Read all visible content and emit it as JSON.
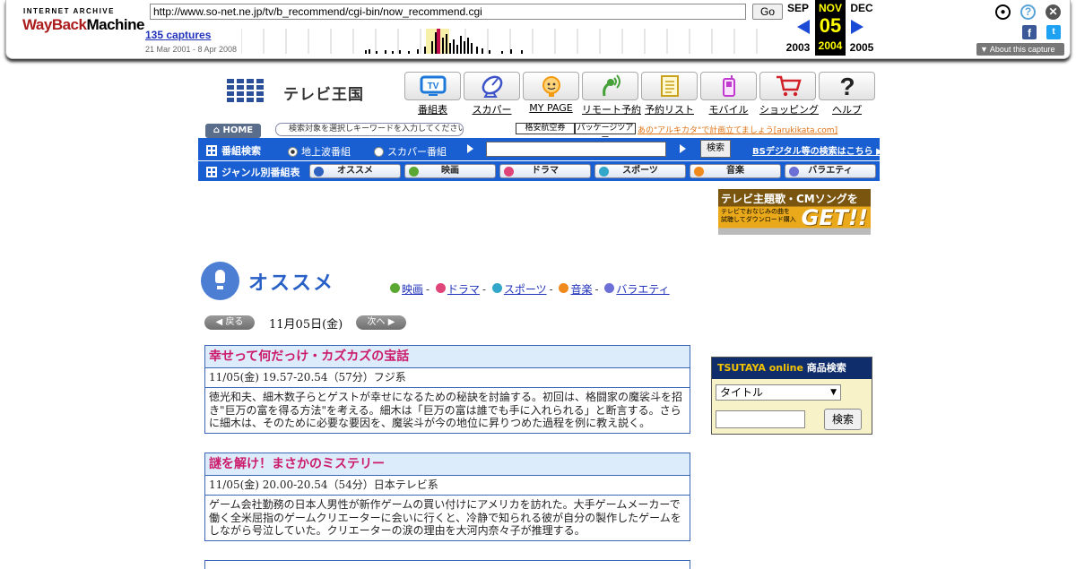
{
  "wayback": {
    "logo_top": "INTERNET ARCHIVE",
    "logo_red": "WayBack",
    "logo_black": "Machine",
    "url": "http://www.so-net.ne.jp/tv/b_recommend/cgi-bin/now_recommend.cgi",
    "go_label": "Go",
    "captures": "135 captures",
    "range": "21 Mar 2001 - 8 Apr 2008",
    "prev_month": "SEP",
    "prev_year": "2003",
    "cur_month": "NOV",
    "cur_day": "05",
    "cur_year": "2004",
    "next_month": "DEC",
    "next_year": "2005",
    "about": "About this capture",
    "accent": "#1a4ad6"
  },
  "site": {
    "brand": "テレビ王国",
    "nav": [
      "番組表",
      "スカパー",
      "MY PAGE",
      "リモート予約",
      "予約リスト",
      "モバイル",
      "ショッピング",
      "ヘルプ"
    ],
    "nav_icons": [
      "tv-icon",
      "satellite-dish-icon",
      "face-icon",
      "remote-icon",
      "checklist-icon",
      "mobile-phone-icon",
      "shopping-cart-icon",
      "question-mark-icon"
    ]
  },
  "search": {
    "home": "HOME",
    "hint": "検索対象を選択しキーワードを入力してください",
    "ad1": "格安航空券",
    "ad2": "パッケージツアー",
    "ad_text": "あの\"アルキカタ\"で計画立てましょう[arukikata.com]",
    "section": "番組検索",
    "radio1": "地上波番組",
    "radio2": "スカパー番組",
    "button": "検索",
    "bs_link": "BSデジタル等の検索はこちら"
  },
  "genre": {
    "section": "ジャンル別番組表",
    "items": [
      {
        "label": "オススメ",
        "color": "#2f62c0"
      },
      {
        "label": "映画",
        "color": "#5aa832"
      },
      {
        "label": "ドラマ",
        "color": "#e0457a"
      },
      {
        "label": "スポーツ",
        "color": "#33a7c9"
      },
      {
        "label": "音楽",
        "color": "#f08a1c"
      },
      {
        "label": "バラエティ",
        "color": "#6b6fd6"
      }
    ]
  },
  "banner": {
    "line1": "テレビ主題歌・CMソングを",
    "line2": "テレビでおなじみの曲を",
    "line3": "試聴してダウンロード購入",
    "cta": "GET!!"
  },
  "page": {
    "title": "オススメ",
    "links": [
      {
        "label": "映画",
        "color": "#5aa832"
      },
      {
        "label": "ドラマ",
        "color": "#e0457a"
      },
      {
        "label": "スポーツ",
        "color": "#33a7c9"
      },
      {
        "label": "音楽",
        "color": "#f08a1c"
      },
      {
        "label": "バラエティ",
        "color": "#6b6fd6"
      }
    ],
    "prev": "戻る",
    "next": "次へ",
    "date": "11月05日(金)"
  },
  "programs": [
    {
      "title": "幸せって何だっけ・カズカズの宝話",
      "time": "11/05(金) 19.57-20.54（57分）フジ系",
      "desc": "徳光和夫、細木数子らとゲストが幸せになるための秘訣を討論する。初回は、格闘家の魔裟斗を招き\"巨万の富を得る方法\"を考える。細木は「巨万の富は誰でも手に入れられる」と断言する。さらに細木は、そのために必要な要因を、魔裟斗が今の地位に昇りつめた過程を例に教え説く。"
    },
    {
      "title": "謎を解け！まさかのミステリー",
      "time": "11/05(金) 20.00-20.54（54分）日本テレビ系",
      "desc": "ゲーム会社勤務の日本人男性が新作ゲームの買い付けにアメリカを訪れた。大手ゲームメーカーで働く全米屈指のゲームクリエーターに会いに行くと、冷静で知られる彼が自分の製作したゲームをしながら号泣していた。クリエーターの涙の理由を大河内奈々子が推理する。"
    }
  ],
  "tsutaya": {
    "brand": "TSUTAYA online",
    "suffix": "商品検索",
    "select": "タイトル",
    "button": "検索"
  }
}
